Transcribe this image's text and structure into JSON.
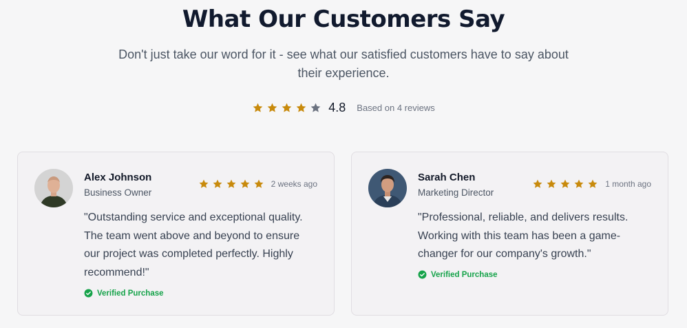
{
  "header": {
    "title": "What Our Customers Say",
    "subtitle": "Don't just take our word for it - see what our satisfied customers have to say about their experience."
  },
  "summary": {
    "average": "4.8",
    "rating_value": 4.8,
    "based_on": "Based on 4 reviews"
  },
  "colors": {
    "star_filled": "#c88a0c",
    "star_empty": "#6b7280",
    "verified": "#16a34a"
  },
  "reviews": [
    {
      "name": "Alex Johnson",
      "role": "Business Owner",
      "rating": 5,
      "time": "2 weeks ago",
      "quote": "\"Outstanding service and exceptional quality. The team went above and beyond to ensure our project was completed perfectly. Highly recommend!\"",
      "verified_label": "Verified Purchase"
    },
    {
      "name": "Sarah Chen",
      "role": "Marketing Director",
      "rating": 5,
      "time": "1 month ago",
      "quote": "\"Professional, reliable, and delivers results. Working with this team has been a game-changer for our company's growth.\"",
      "verified_label": "Verified Purchase"
    }
  ]
}
